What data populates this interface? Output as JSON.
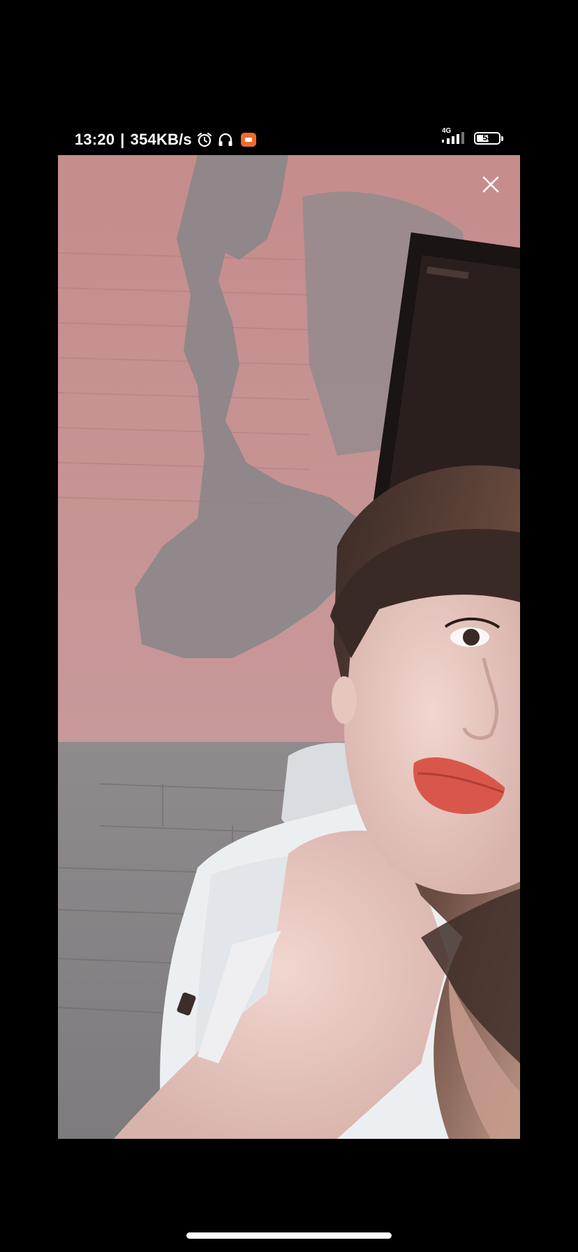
{
  "status_bar": {
    "time": "13:20",
    "separator": "|",
    "network_speed": "354KB/s",
    "icons": [
      "alarm-icon",
      "headphones-icon",
      "screen-record-icon"
    ],
    "network_type": "4G",
    "signal_strength": 0.8,
    "battery_percent": "58",
    "battery_level": 0.58
  },
  "video_player": {
    "close_icon": "close-icon",
    "colors": {
      "wall_pink": "#c99291",
      "wall_gray": "#868486",
      "shirt_white": "#eceff2",
      "lips": "#d9574a"
    }
  },
  "home_indicator": {
    "color": "#ffffff"
  }
}
